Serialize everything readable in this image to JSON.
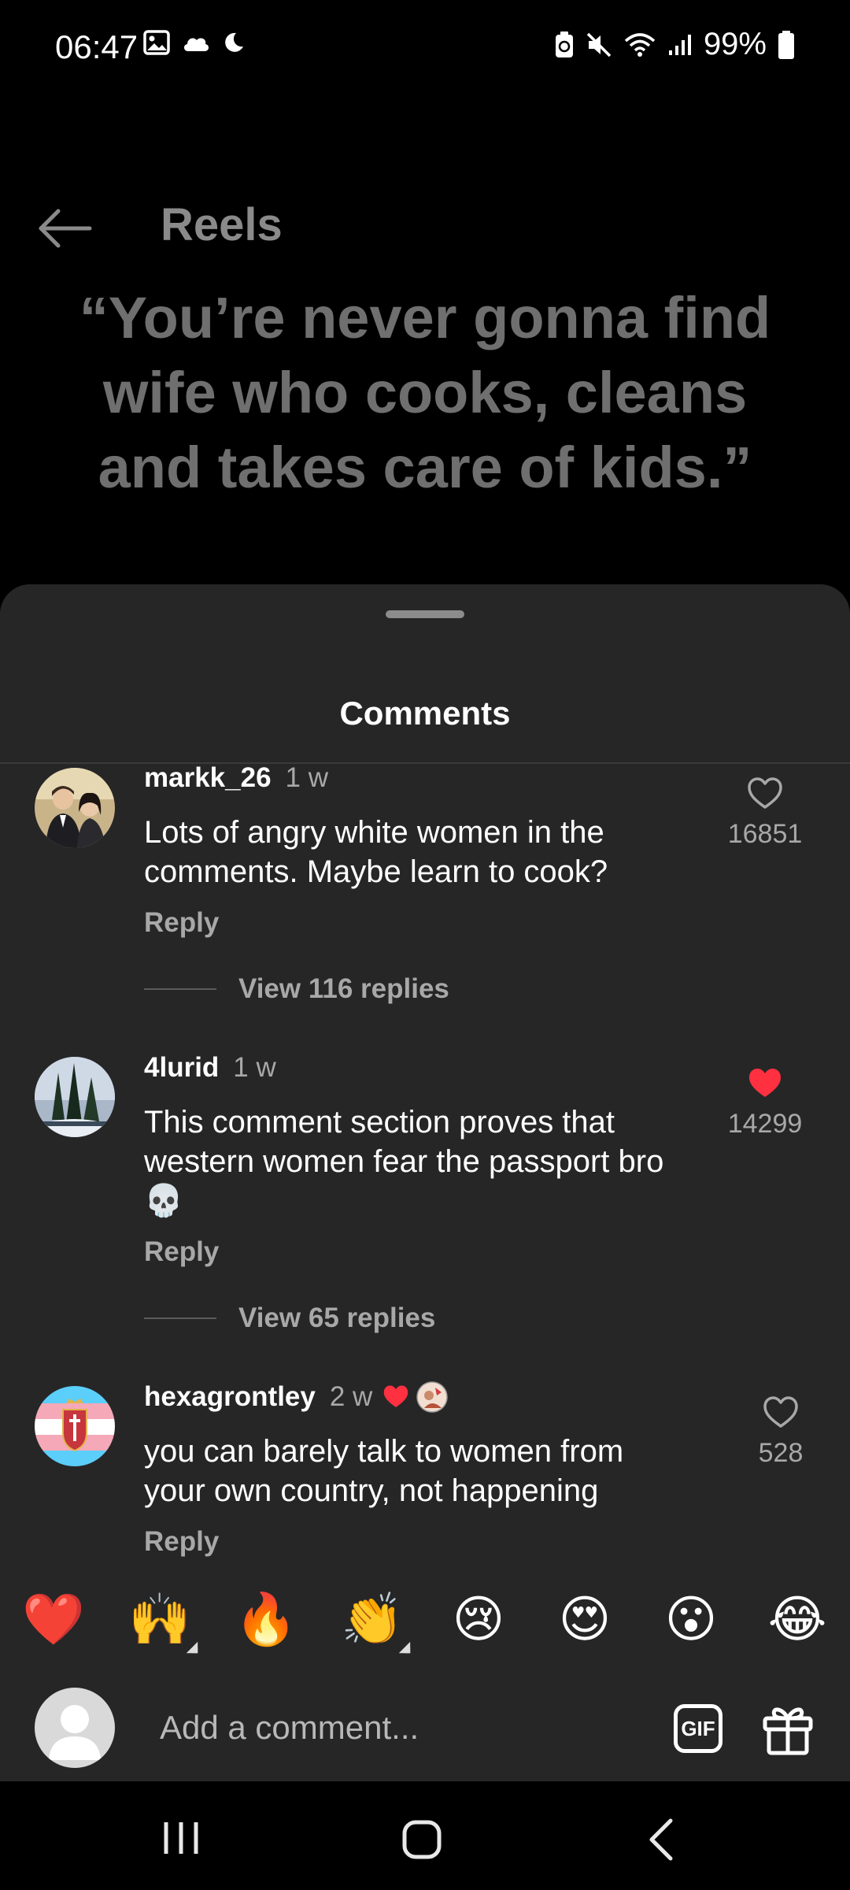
{
  "status_bar": {
    "time": "06:47",
    "battery": "99%",
    "icons_left": [
      "gallery-icon",
      "cloud-icon",
      "moon-icon"
    ],
    "icons_right": [
      "battery-saver-icon",
      "mute-icon",
      "wifi-icon",
      "signal-icon",
      "battery-icon"
    ]
  },
  "header": {
    "title": "Reels"
  },
  "video": {
    "quote": "“You’re never gonna find wife who cooks, cleans and takes care of kids.”"
  },
  "sheet": {
    "title": "Comments"
  },
  "comments": [
    {
      "username": "markk_26",
      "time": "1 w",
      "text": "Lots of angry white women in the comments. Maybe learn to cook?",
      "reply": "Reply",
      "likes": "16851",
      "liked": false,
      "view_replies": "View 116 replies"
    },
    {
      "username": "4lurid",
      "time": "1 w",
      "text": "This comment section proves that western women fear the passport bro 💀",
      "reply": "Reply",
      "likes": "14299",
      "liked": true,
      "view_replies": "View 65 replies"
    },
    {
      "username": "hexagrontley",
      "time": "2 w",
      "text": "you can barely talk to women from your own country, not happening",
      "reply": "Reply",
      "likes": "528",
      "liked": false,
      "author_liked_badge": "heart-icon"
    }
  ],
  "emoji_bar": [
    "❤️",
    "🙌",
    "🔥",
    "👏",
    "😢",
    "😍",
    "😮",
    "😂"
  ],
  "compose": {
    "placeholder": "Add a comment...",
    "gif_label": "GIF"
  },
  "colors": {
    "sheet_bg": "#262627",
    "like_red": "#ff3040",
    "muted_text": "#a8a8a8"
  }
}
